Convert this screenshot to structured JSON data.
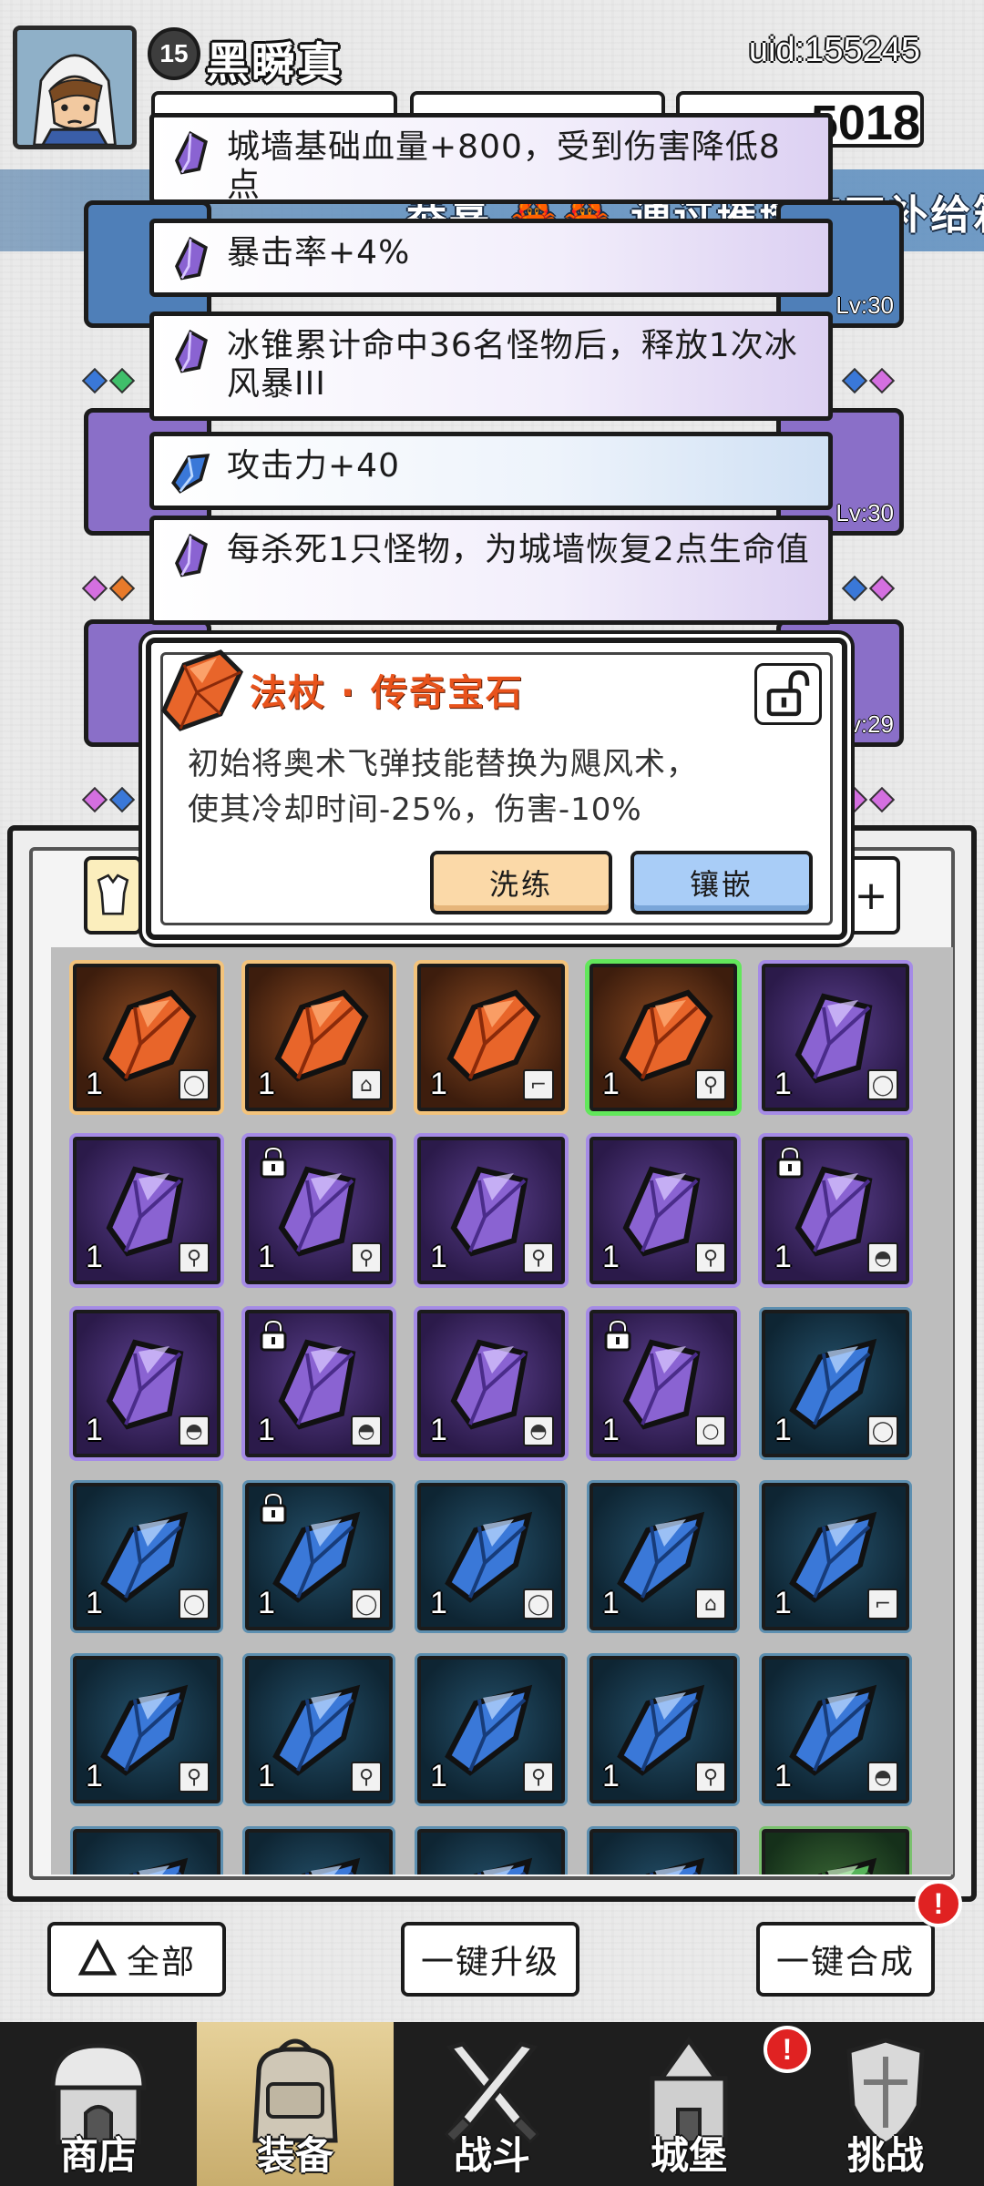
{
  "header": {
    "level": "15",
    "player_name": "黑瞬真",
    "uid": "uid:155245",
    "currency_partial": "5018"
  },
  "banner": {
    "prefix": "恭喜",
    "crabs": "🦀🦀",
    "message": "通过璀璨宝石补给箱获"
  },
  "equip_slots": {
    "levels": [
      "Lv:30",
      "Lv:30",
      "Lv:29"
    ]
  },
  "affixes": [
    {
      "text": "城墙基础血量+800，受到伤害降低8点",
      "color": "purple"
    },
    {
      "text": "暴击率+4%",
      "color": "purple"
    },
    {
      "text": "冰锥累计命中36名怪物后，释放1次冰风暴III",
      "color": "purple"
    },
    {
      "text": "攻击力+40",
      "color": "blue"
    },
    {
      "text": "每杀死1只怪物，为城墙恢复2点生命值",
      "color": "purple"
    }
  ],
  "popup": {
    "title": "法杖 · 传奇宝石",
    "description_line1": "初始将奥术飞弹技能替换为飓风术，",
    "description_line2": "使其冷却时间-25%，伤害-10%",
    "refine_label": "洗练",
    "inlay_label": "镶嵌"
  },
  "inventory": {
    "plus_label": "+",
    "rows": [
      [
        {
          "rarity": "legend",
          "count": "1",
          "type": "ring",
          "locked": false
        },
        {
          "rarity": "legend",
          "count": "1",
          "type": "armor",
          "locked": false
        },
        {
          "rarity": "legend",
          "count": "1",
          "type": "boots",
          "locked": false
        },
        {
          "rarity": "legend",
          "count": "1",
          "type": "staff",
          "locked": false,
          "selected": true
        },
        {
          "rarity": "purple",
          "count": "1",
          "type": "ring",
          "locked": false
        }
      ],
      [
        {
          "rarity": "purple",
          "count": "1",
          "type": "staff",
          "locked": false
        },
        {
          "rarity": "purple",
          "count": "1",
          "type": "staff",
          "locked": true
        },
        {
          "rarity": "purple",
          "count": "1",
          "type": "staff",
          "locked": false
        },
        {
          "rarity": "purple",
          "count": "1",
          "type": "staff",
          "locked": false
        },
        {
          "rarity": "purple",
          "count": "1",
          "type": "hat",
          "locked": true
        }
      ],
      [
        {
          "rarity": "purple",
          "count": "1",
          "type": "hat",
          "locked": false
        },
        {
          "rarity": "purple",
          "count": "1",
          "type": "hat",
          "locked": true
        },
        {
          "rarity": "purple",
          "count": "1",
          "type": "hat",
          "locked": false
        },
        {
          "rarity": "purple",
          "count": "1",
          "type": "necklace",
          "locked": true
        },
        {
          "rarity": "blue",
          "count": "1",
          "type": "ring",
          "locked": false
        }
      ],
      [
        {
          "rarity": "blue",
          "count": "1",
          "type": "ring",
          "locked": false
        },
        {
          "rarity": "blue",
          "count": "1",
          "type": "ring",
          "locked": true
        },
        {
          "rarity": "blue",
          "count": "1",
          "type": "ring",
          "locked": false
        },
        {
          "rarity": "blue",
          "count": "1",
          "type": "armor",
          "locked": false
        },
        {
          "rarity": "blue",
          "count": "1",
          "type": "boots",
          "locked": false
        }
      ],
      [
        {
          "rarity": "blue",
          "count": "1",
          "type": "staff",
          "locked": false
        },
        {
          "rarity": "blue",
          "count": "1",
          "type": "staff",
          "locked": false
        },
        {
          "rarity": "blue",
          "count": "1",
          "type": "staff",
          "locked": false
        },
        {
          "rarity": "blue",
          "count": "1",
          "type": "staff",
          "locked": false
        },
        {
          "rarity": "blue",
          "count": "1",
          "type": "hat",
          "locked": false
        }
      ],
      [
        {
          "rarity": "blue",
          "count": "",
          "type": "",
          "locked": false
        },
        {
          "rarity": "blue",
          "count": "",
          "type": "",
          "locked": false
        },
        {
          "rarity": "blue",
          "count": "",
          "type": "",
          "locked": false
        },
        {
          "rarity": "blue",
          "count": "",
          "type": "",
          "locked": false
        },
        {
          "rarity": "green",
          "count": "",
          "type": "",
          "locked": false
        }
      ]
    ]
  },
  "actions": {
    "filter_label": "全部",
    "upgrade_label": "一键升级",
    "merge_label": "一键合成",
    "alert": "!"
  },
  "nav": [
    {
      "label": "商店",
      "icon": "shop-icon"
    },
    {
      "label": "装备",
      "icon": "backpack-icon",
      "active": true
    },
    {
      "label": "战斗",
      "icon": "crossed-swords-icon"
    },
    {
      "label": "城堡",
      "icon": "castle-icon",
      "alert": "!"
    },
    {
      "label": "挑战",
      "icon": "shield-emblem-icon"
    }
  ],
  "colors": {
    "legend_orange": "#e8531c",
    "purple_gem": "#8a63d2",
    "blue_gem": "#3a78d8",
    "refine_button": "#fbd9a8",
    "inlay_button": "#a9cdf7",
    "alert_red": "#e02222",
    "selected_border": "#62e75b"
  }
}
